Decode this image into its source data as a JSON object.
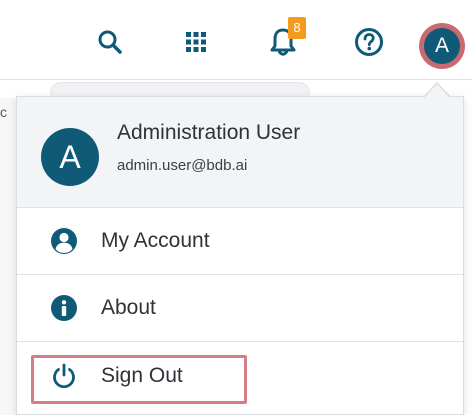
{
  "topbar": {
    "icons": [
      "search-icon",
      "apps-grid-icon",
      "bell-icon",
      "help-icon"
    ],
    "notification_count": "8",
    "avatar_initial": "A",
    "accent_color": "#0f5a76",
    "badge_color": "#f39b1e"
  },
  "background": {
    "edge_char": "c"
  },
  "dropdown": {
    "profile": {
      "initial": "A",
      "name": "Administration User",
      "email": "admin.user@bdb.ai"
    },
    "items": [
      {
        "label": "My Account",
        "icon": "user-circle-icon"
      },
      {
        "label": "About",
        "icon": "info-icon"
      },
      {
        "label": "Sign Out",
        "icon": "power-icon"
      }
    ],
    "highlight_color": "#d47e86"
  }
}
